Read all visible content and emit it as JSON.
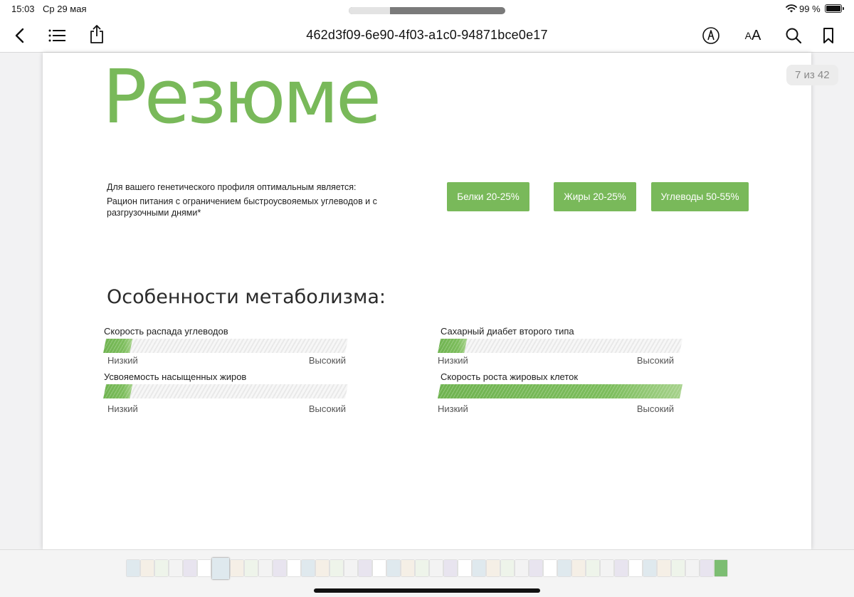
{
  "status": {
    "time": "15:03",
    "date": "Ср 29 мая",
    "battery": "99 %"
  },
  "toolbar": {
    "title": "462d3f09-6e90-4f03-a1c0-94871bce0e17",
    "text_size_label": "A",
    "text_size_label_small": "A"
  },
  "page_counter": "7 из 42",
  "document": {
    "title": "Резюме",
    "profile_lead": "Для вашего генетического профиля оптимальным является:",
    "profile_diet": "Рацион питания с ограничением быстроусвояемых углеводов и с разгрузочными днями*",
    "macros": [
      {
        "label": "Белки 20-25%"
      },
      {
        "label": "Жиры  20-25%"
      },
      {
        "label": "Углеводы 50-55%"
      }
    ],
    "metabolism_heading": "Особенности метаболизма:",
    "metrics": [
      {
        "label": "Скорость распада углеводов",
        "low": "Низкий",
        "high": "Высокий",
        "level": 0.12
      },
      {
        "label": "Сахарный диабет второго типа",
        "low": "Низкий",
        "high": "Высокий",
        "level": 0.12
      },
      {
        "label": "Усвояемость насыщенных жиров",
        "low": "Низкий",
        "high": "Высокий",
        "level": 0.12
      },
      {
        "label": "Скорость роста жировых клеток",
        "low": "Низкий",
        "high": "Высокий",
        "level": 1.0
      }
    ]
  },
  "thumbnails": {
    "count": 42,
    "current": 7
  },
  "colors": {
    "accent_green": "#79b95a",
    "counter_bg": "#ececec"
  },
  "icons": {
    "back": "chevron-left-icon",
    "toc": "list-icon",
    "share": "share-icon",
    "markup": "pen-circle-icon",
    "search": "search-icon",
    "bookmark": "bookmark-icon",
    "wifi": "wifi-icon",
    "battery": "battery-icon"
  }
}
